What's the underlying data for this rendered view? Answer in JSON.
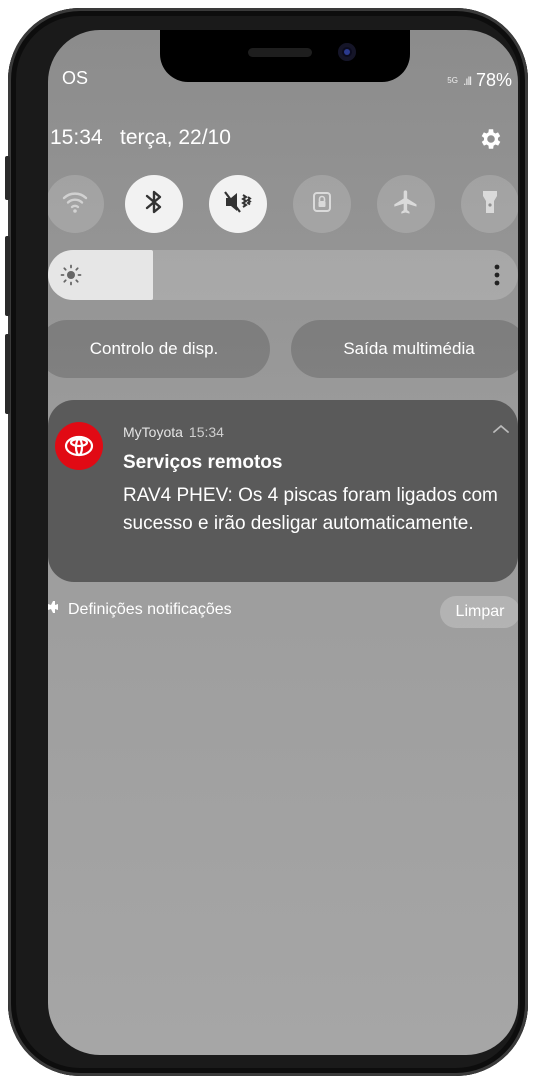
{
  "status_bar": {
    "carrier_fragment": "OS",
    "network": "5G",
    "battery": "78%"
  },
  "header": {
    "time": "15:34",
    "date": "terça, 22/10"
  },
  "quick_settings": [
    {
      "icon": "wifi-icon",
      "active": false
    },
    {
      "icon": "bluetooth-icon",
      "active": true
    },
    {
      "icon": "vibrate-mute-icon",
      "active": true
    },
    {
      "icon": "lock-icon",
      "active": false
    },
    {
      "icon": "airplane-icon",
      "active": false
    },
    {
      "icon": "flashlight-icon",
      "active": false
    }
  ],
  "brightness": {
    "level": 0.22
  },
  "buttons": {
    "device_control": "Controlo de disp.",
    "media_output": "Saída multimédia"
  },
  "notification": {
    "app_name": "MyToyota",
    "time": "15:34",
    "title": "Serviços remotos",
    "body": "RAV4 PHEV: Os 4 piscas foram ligados com sucesso e irão desligar automaticamente.",
    "brand_color": "#e10a14"
  },
  "footer": {
    "settings_label": "Definições notificações",
    "clear_label": "Limpar"
  }
}
